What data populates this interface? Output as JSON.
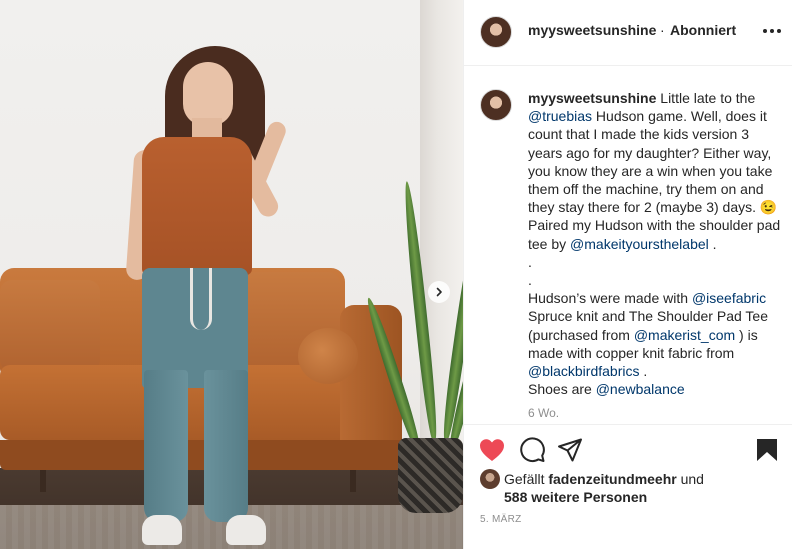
{
  "post": {
    "username": "myysweetsunshine",
    "separator": "·",
    "follow_status": "Abonniert",
    "caption": {
      "username": "myysweetsunshine",
      "segments": [
        {
          "text": " Little late to the ",
          "mention": false
        },
        {
          "text": "@truebias",
          "mention": true
        },
        {
          "text": " Hudson game. Well, does it count that I made the kids version 3 years ago for my daughter? Either way, you know they are a win when you take them off the machine, try them on and they stay there for 2 (maybe 3) days. 😉 Paired my Hudson with the shoulder pad tee by ",
          "mention": false
        },
        {
          "text": "@makeityoursthelabel",
          "mention": true
        },
        {
          "text": " .",
          "mention": false
        }
      ],
      "dot_lines": [
        ".",
        "."
      ],
      "paragraph2": [
        {
          "text": "Hudson’s were made with ",
          "mention": false
        },
        {
          "text": "@iseefabric",
          "mention": true
        },
        {
          "text": " Spruce knit and The Shoulder Pad Tee (purchased from ",
          "mention": false
        },
        {
          "text": "@makerist_com",
          "mention": true
        },
        {
          "text": " ) is made with copper knit fabric from ",
          "mention": false
        },
        {
          "text": "@blackbirdfabrics",
          "mention": true
        },
        {
          "text": " .",
          "mention": false
        }
      ],
      "shoes_line": [
        {
          "text": "Shoes are ",
          "mention": false
        },
        {
          "text": "@newbalance",
          "mention": true
        }
      ]
    },
    "time_ago": "6 Wo.",
    "likes": {
      "prefix": "Gefällt ",
      "liked_by": "fadenzeitundmeehr",
      "connector": " und",
      "others": "588 weitere Personen"
    },
    "date": "5. MÄRZ"
  },
  "icons": {
    "like": "heart-icon",
    "comment": "comment-icon",
    "share": "share-icon",
    "save": "bookmark-icon",
    "more": "more-options-icon",
    "next": "chevron-right-icon"
  },
  "colors": {
    "text": "#262626",
    "mention": "#00376b",
    "muted": "#8e8e8e",
    "like_red": "#ed4956",
    "border": "#efefef"
  }
}
